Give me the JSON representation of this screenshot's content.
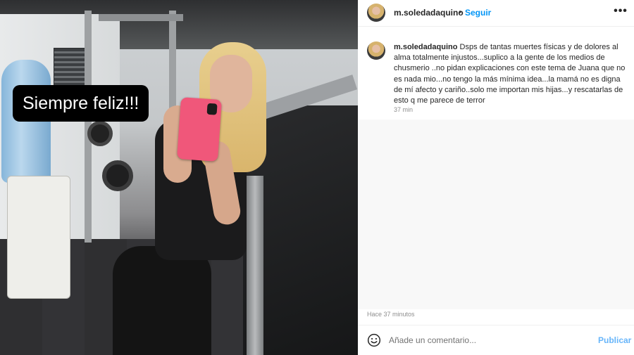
{
  "photo": {
    "sticker_text": "Siempre feliz!!!"
  },
  "post": {
    "username": "m.soledadaquino",
    "separator": "•",
    "follow_label": "Seguir",
    "more_icon": "ellipsis-icon",
    "more_label": "•••",
    "caption_user": "m.soledadaquino",
    "caption_text": "Dsps de tantas muertes físicas y de dolores al alma totalmente injustos...suplico a la gente de los medios de chusmerio ..no pidan explicaciones con este tema de Juana que no es nada mio...no tengo la más mínima idea...la mamá no es digna de mí afecto y cariño..solo me importan mis hijas...y rescatarlas de esto q me parece de terror",
    "caption_time": "37 min",
    "post_time": "Hace 37 minutos"
  },
  "comment": {
    "emoji_icon": "smiley-icon",
    "placeholder": "Añade un comentario...",
    "publish_label": "Publicar"
  },
  "colors": {
    "link_blue": "#0095f6",
    "publish_blue": "#67b5fa",
    "muted": "#8e8e8e"
  }
}
